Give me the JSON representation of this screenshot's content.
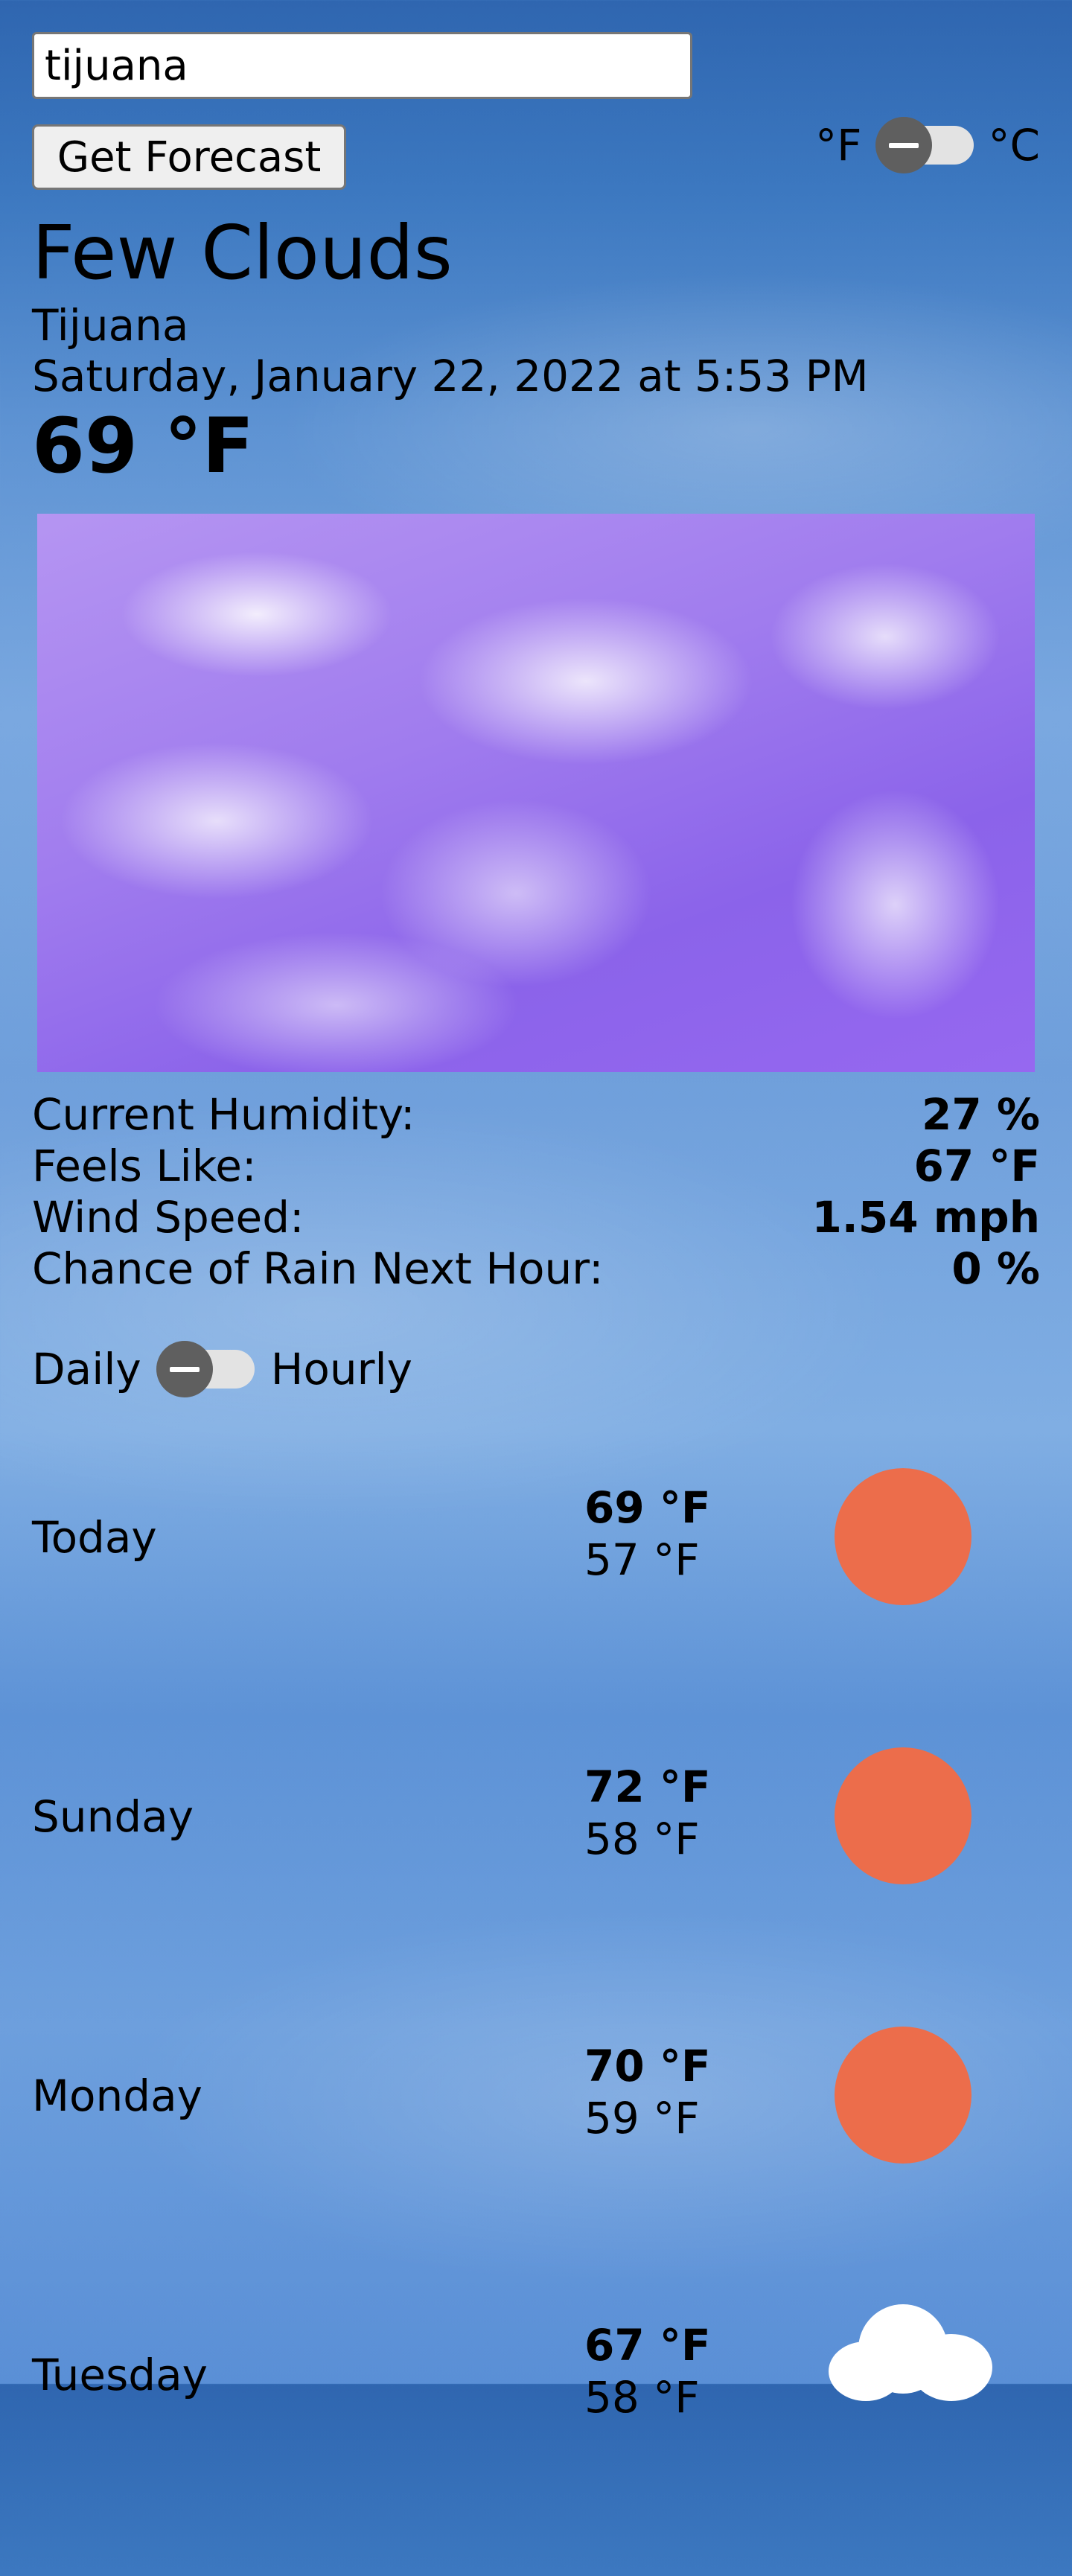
{
  "search": {
    "value": "tijuana",
    "button_label": "Get Forecast"
  },
  "units": {
    "left_label": "°F",
    "right_label": "°C",
    "selected": "°F"
  },
  "current": {
    "condition": "Few Clouds",
    "city": "Tijuana",
    "datetime": "Saturday, January 22, 2022 at 5:53 PM",
    "temperature": "69 °F"
  },
  "stats": [
    {
      "label": "Current Humidity:",
      "value": "27 %"
    },
    {
      "label": "Feels Like:",
      "value": "67 °F"
    },
    {
      "label": "Wind Speed:",
      "value": "1.54 mph"
    },
    {
      "label": "Chance of Rain Next Hour:",
      "value": "0 %"
    }
  ],
  "view": {
    "left_label": "Daily",
    "right_label": "Hourly",
    "selected": "Daily"
  },
  "forecast": [
    {
      "day": "Today",
      "high": "69 °F",
      "low": "57 °F",
      "icon": "sun-icon",
      "icon_color": "#ec6d4b"
    },
    {
      "day": "Sunday",
      "high": "72 °F",
      "low": "58 °F",
      "icon": "sun-icon",
      "icon_color": "#ec6d4b"
    },
    {
      "day": "Monday",
      "high": "70 °F",
      "low": "59 °F",
      "icon": "sun-icon",
      "icon_color": "#ec6d4b"
    },
    {
      "day": "Tuesday",
      "high": "67 °F",
      "low": "58 °F",
      "icon": "cloud-icon",
      "icon_color": "#ffffff"
    }
  ]
}
